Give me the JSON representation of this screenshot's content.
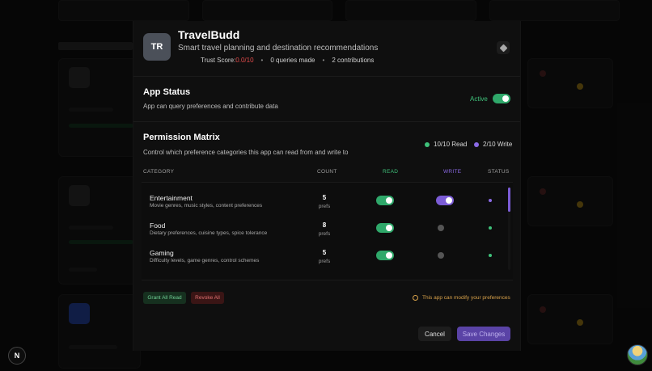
{
  "app": {
    "initials": "TR",
    "name": "TravelBudd",
    "description": "Smart travel planning and destination recommendations",
    "trust_label": "Trust Score: ",
    "trust_value": "0.0/10",
    "queries": "0 queries made",
    "contributions": "2 contributions",
    "separator": "•"
  },
  "status": {
    "title": "App Status",
    "description": "App can query preferences and contribute data",
    "active_label": "Active",
    "active": true
  },
  "permissions": {
    "title": "Permission Matrix",
    "description": "Control which preference categories this app can read from and write to",
    "read_summary": "10/10 Read",
    "write_summary": "2/10 Write",
    "columns": {
      "category": "CATEGORY",
      "count": "COUNT",
      "read": "READ",
      "write": "WRITE",
      "status": "STATUS"
    },
    "rows": [
      {
        "category": "Entertainment",
        "description": "Movie genres, music styles, content preferences",
        "count": "5",
        "unit": "prefs",
        "read": true,
        "write": true
      },
      {
        "category": "Food",
        "description": "Dietary preferences, cuisine types, spice tolerance",
        "count": "8",
        "unit": "prefs",
        "read": true,
        "write": false
      },
      {
        "category": "Gaming",
        "description": "Difficulty levels, game genres, control schemes",
        "count": "5",
        "unit": "prefs",
        "read": true,
        "write": false
      }
    ]
  },
  "actions": {
    "grant_all": "Grant All Read",
    "revoke_all": "Revoke All",
    "warning": "This app can modify your preferences",
    "cancel": "Cancel",
    "save": "Save Changes"
  },
  "corner": {
    "badge": "N"
  },
  "colors": {
    "read_accent": "#3fc17a",
    "write_accent": "#8b6ae6",
    "danger": "#e04a4a",
    "warning": "#d9a24a"
  }
}
